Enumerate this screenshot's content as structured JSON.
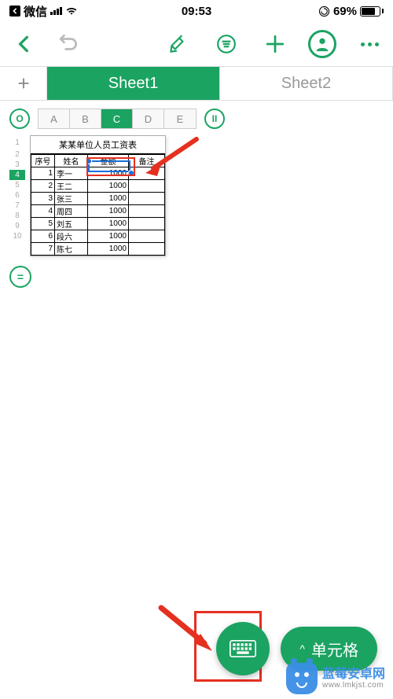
{
  "status": {
    "carrier": "微信",
    "time": "09:53",
    "battery_pct": "69%"
  },
  "tabs": {
    "sheet1": "Sheet1",
    "sheet2": "Sheet2"
  },
  "cols": [
    "A",
    "B",
    "C",
    "D",
    "E"
  ],
  "rows": [
    "1",
    "2",
    "3",
    "4",
    "5",
    "6",
    "7",
    "8",
    "9",
    "10"
  ],
  "selected_col": "C",
  "selected_row": "4",
  "pause_label": "II",
  "circle_o_label": "O",
  "formula_label": "=",
  "table": {
    "title": "某某单位人员工资表",
    "headers": {
      "seq": "序号",
      "name": "姓名",
      "amount": "金额",
      "note": "备注"
    },
    "rows": [
      {
        "seq": "1",
        "name": "李一",
        "amount": "1000",
        "note": ""
      },
      {
        "seq": "2",
        "name": "王二",
        "amount": "1000",
        "note": ""
      },
      {
        "seq": "3",
        "name": "张三",
        "amount": "1000",
        "note": ""
      },
      {
        "seq": "4",
        "name": "周四",
        "amount": "1000",
        "note": ""
      },
      {
        "seq": "5",
        "name": "刘五",
        "amount": "1000",
        "note": ""
      },
      {
        "seq": "6",
        "name": "段六",
        "amount": "1000",
        "note": ""
      },
      {
        "seq": "7",
        "name": "陈七",
        "amount": "1000",
        "note": ""
      }
    ]
  },
  "fab": {
    "pill_label": "单元格",
    "chevron": "^"
  },
  "watermark": {
    "title": "蓝莓安卓网",
    "url": "www.lmkjst.com"
  }
}
